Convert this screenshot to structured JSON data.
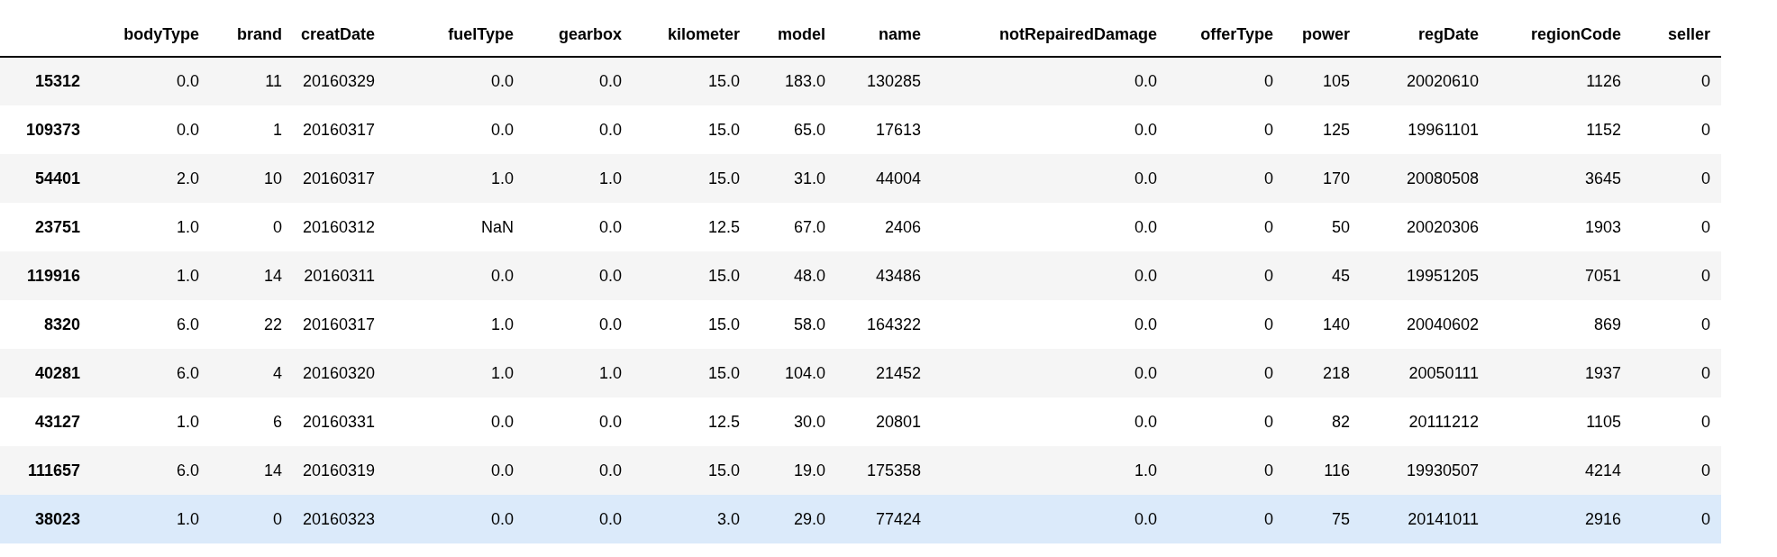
{
  "table": {
    "columns": [
      "bodyType",
      "brand",
      "creatDate",
      "fuelType",
      "gearbox",
      "kilometer",
      "model",
      "name",
      "notRepairedDamage",
      "offerType",
      "power",
      "regDate",
      "regionCode",
      "seller"
    ],
    "rows": [
      {
        "index": "15312",
        "cells": [
          "0.0",
          "11",
          "20160329",
          "0.0",
          "0.0",
          "15.0",
          "183.0",
          "130285",
          "0.0",
          "0",
          "105",
          "20020610",
          "1126",
          "0"
        ],
        "selected": false
      },
      {
        "index": "109373",
        "cells": [
          "0.0",
          "1",
          "20160317",
          "0.0",
          "0.0",
          "15.0",
          "65.0",
          "17613",
          "0.0",
          "0",
          "125",
          "19961101",
          "1152",
          "0"
        ],
        "selected": false
      },
      {
        "index": "54401",
        "cells": [
          "2.0",
          "10",
          "20160317",
          "1.0",
          "1.0",
          "15.0",
          "31.0",
          "44004",
          "0.0",
          "0",
          "170",
          "20080508",
          "3645",
          "0"
        ],
        "selected": false
      },
      {
        "index": "23751",
        "cells": [
          "1.0",
          "0",
          "20160312",
          "NaN",
          "0.0",
          "12.5",
          "67.0",
          "2406",
          "0.0",
          "0",
          "50",
          "20020306",
          "1903",
          "0"
        ],
        "selected": false
      },
      {
        "index": "119916",
        "cells": [
          "1.0",
          "14",
          "20160311",
          "0.0",
          "0.0",
          "15.0",
          "48.0",
          "43486",
          "0.0",
          "0",
          "45",
          "19951205",
          "7051",
          "0"
        ],
        "selected": false
      },
      {
        "index": "8320",
        "cells": [
          "6.0",
          "22",
          "20160317",
          "1.0",
          "0.0",
          "15.0",
          "58.0",
          "164322",
          "0.0",
          "0",
          "140",
          "20040602",
          "869",
          "0"
        ],
        "selected": false
      },
      {
        "index": "40281",
        "cells": [
          "6.0",
          "4",
          "20160320",
          "1.0",
          "1.0",
          "15.0",
          "104.0",
          "21452",
          "0.0",
          "0",
          "218",
          "20050111",
          "1937",
          "0"
        ],
        "selected": false
      },
      {
        "index": "43127",
        "cells": [
          "1.0",
          "6",
          "20160331",
          "0.0",
          "0.0",
          "12.5",
          "30.0",
          "20801",
          "0.0",
          "0",
          "82",
          "20111212",
          "1105",
          "0"
        ],
        "selected": false
      },
      {
        "index": "111657",
        "cells": [
          "6.0",
          "14",
          "20160319",
          "0.0",
          "0.0",
          "15.0",
          "19.0",
          "175358",
          "1.0",
          "0",
          "116",
          "19930507",
          "4214",
          "0"
        ],
        "selected": false
      },
      {
        "index": "38023",
        "cells": [
          "1.0",
          "0",
          "20160323",
          "0.0",
          "0.0",
          "3.0",
          "29.0",
          "77424",
          "0.0",
          "0",
          "75",
          "20141011",
          "2916",
          "0"
        ],
        "selected": true
      }
    ]
  }
}
